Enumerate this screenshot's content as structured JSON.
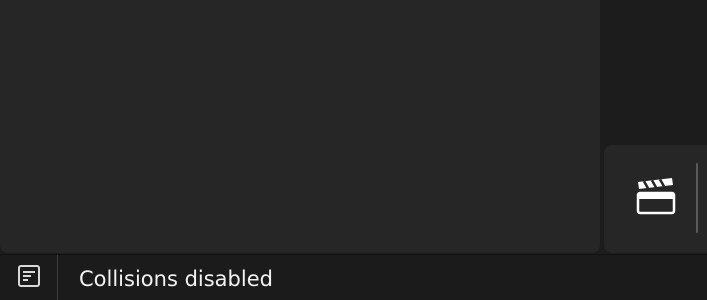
{
  "status_bar": {
    "message": "Collisions disabled",
    "icon": "log-icon"
  },
  "tool_dock": {
    "sequencer_icon": "clapperboard-icon"
  },
  "colors": {
    "panel": "#262626",
    "background": "#1c1c1c",
    "status_text": "#f2f2f2"
  }
}
